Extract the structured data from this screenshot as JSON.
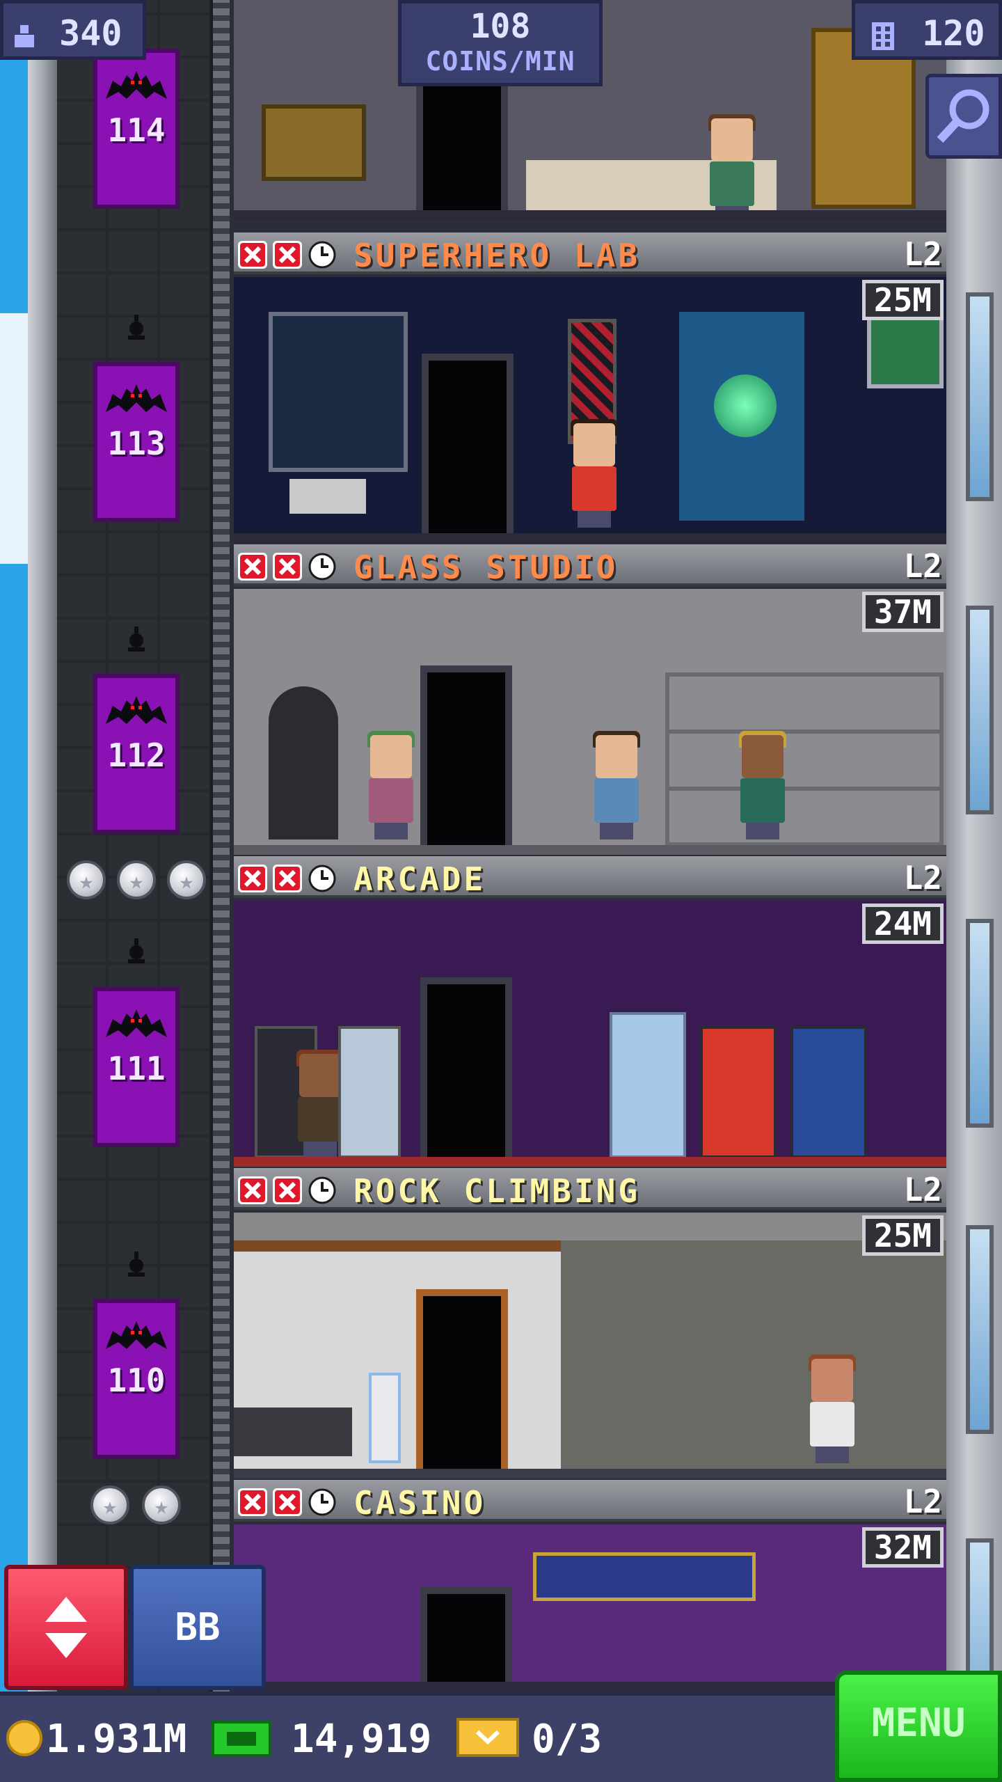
{
  "hud": {
    "population": "340",
    "coins_rate_value": "108",
    "coins_rate_unit": "COINS/MIN",
    "floor_count": "120"
  },
  "elevator": {
    "floors": [
      "114",
      "113",
      "112",
      "111",
      "110"
    ]
  },
  "floors": [
    {
      "name": "SUPERHERO LAB",
      "level": "L2",
      "value": "25M",
      "title_color": "#ff8a4a"
    },
    {
      "name": "GLASS STUDIO",
      "level": "L2",
      "value": "37M",
      "title_color": "#ff8a4a"
    },
    {
      "name": "ARCADE",
      "level": "L2",
      "value": "24M",
      "title_color": "#fff6a6"
    },
    {
      "name": "ROCK CLIMBING",
      "level": "L2",
      "value": "25M",
      "title_color": "#fff6a6"
    },
    {
      "name": "CASINO",
      "level": "L2",
      "value": "32M",
      "title_color": "#fff6a6"
    }
  ],
  "buttons": {
    "bb_label": "BB",
    "menu_label": "MENU"
  },
  "bottom_bar": {
    "coins": "1.931M",
    "bux": "14,919",
    "tickets": "0/3"
  },
  "colors": {
    "elevator": "#8a12b5",
    "hud_bg": "#3b3f6e",
    "menu_green": "#2ad82a",
    "elevator_button_red": "#e8243f"
  },
  "icons": [
    "population-icon",
    "floors-icon",
    "search-icon",
    "bat-icon",
    "close-icon",
    "clock-icon",
    "star-icon",
    "coin-icon",
    "bux-icon",
    "ticket-icon",
    "up-down-arrows-icon"
  ]
}
